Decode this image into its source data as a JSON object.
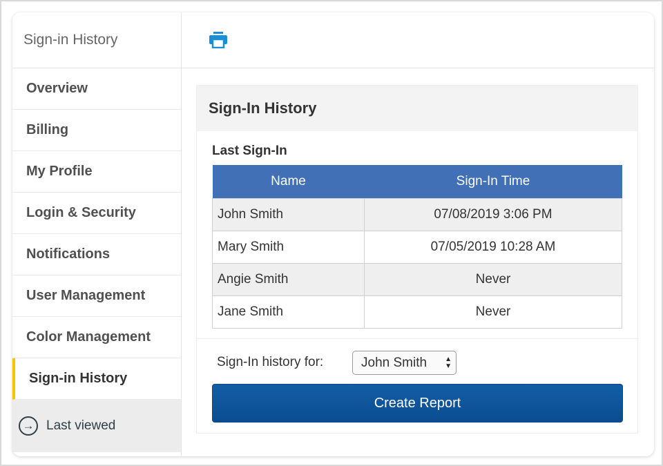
{
  "sidebar": {
    "title": "Sign-in History",
    "items": [
      {
        "label": "Overview"
      },
      {
        "label": "Billing"
      },
      {
        "label": "My Profile"
      },
      {
        "label": "Login & Security"
      },
      {
        "label": "Notifications"
      },
      {
        "label": "User Management"
      },
      {
        "label": "Color Management"
      },
      {
        "label": "Sign-in History",
        "active": true
      }
    ],
    "last_viewed": {
      "label": "Last viewed",
      "icon": "arrow-circle-right-icon"
    }
  },
  "topbar": {
    "print_icon": "print-icon"
  },
  "panel": {
    "title": "Sign-In History",
    "subtitle": "Last Sign-In",
    "table": {
      "columns": [
        "Name",
        "Sign-In Time"
      ],
      "rows": [
        {
          "name": "John Smith",
          "time": "07/08/2019 3:06 PM"
        },
        {
          "name": "Mary Smith",
          "time": "07/05/2019 10:28 AM"
        },
        {
          "name": "Angie Smith",
          "time": "Never"
        },
        {
          "name": "Jane Smith",
          "time": "Never"
        }
      ]
    },
    "history_for_label": "Sign-In history for:",
    "history_for_value": "John Smith",
    "create_report_label": "Create Report"
  },
  "colors": {
    "accent_active": "#f5c400",
    "table_header": "#4170b6",
    "button": "#0f5599",
    "print_icon": "#1a8fd8"
  }
}
